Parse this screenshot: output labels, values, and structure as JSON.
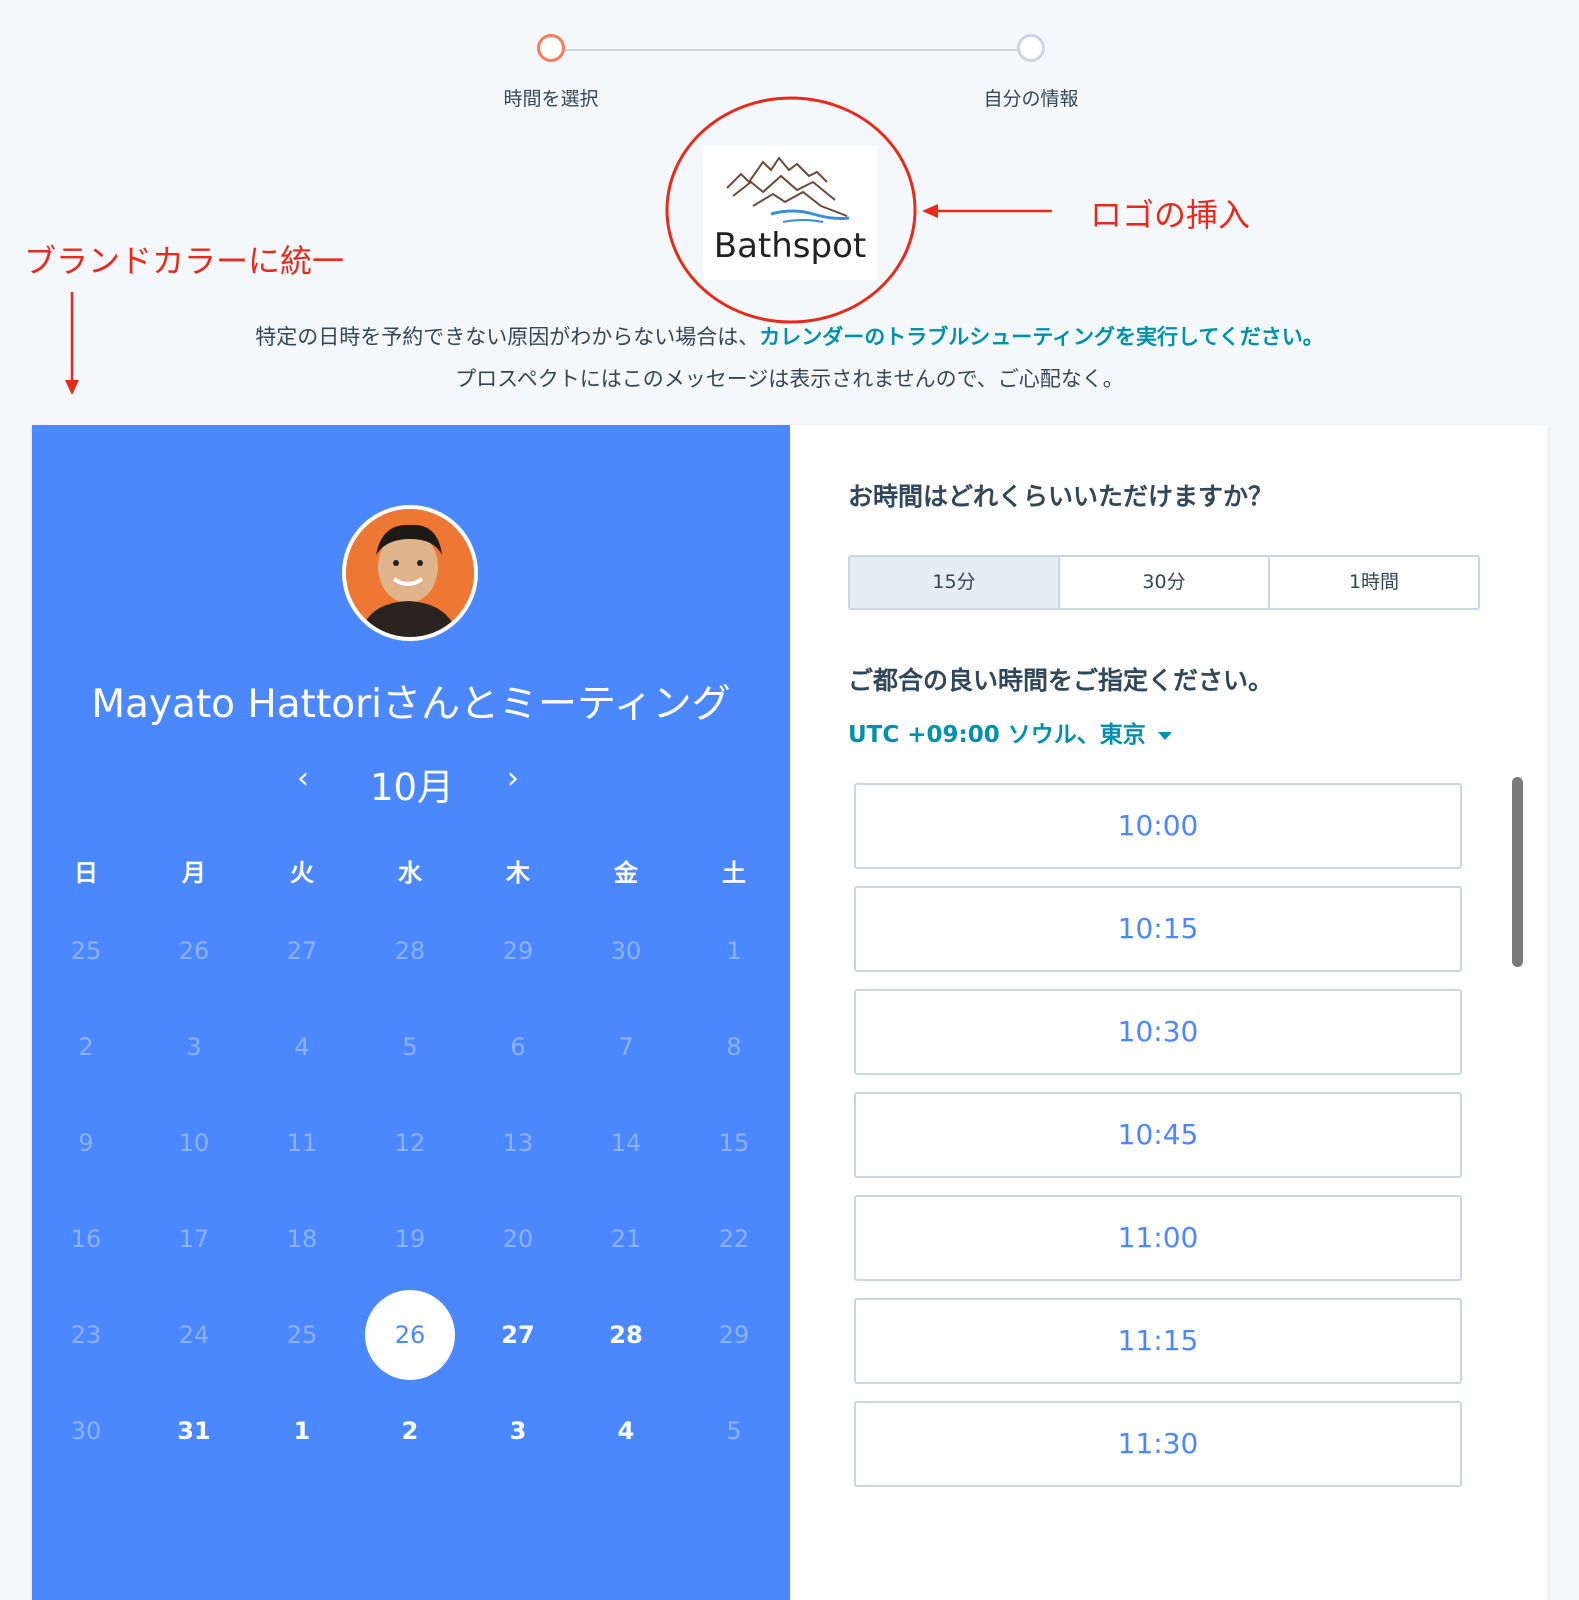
{
  "stepper": {
    "step1_label": "時間を選択",
    "step2_label": "自分の情報"
  },
  "logo": {
    "text": "Bathspot"
  },
  "annotations": {
    "logo_note": "ロゴの挿入",
    "brand_note": "ブランドカラーに統一"
  },
  "info": {
    "line1_prefix": "特定の日時を予約できない原因がわからない場合は、",
    "line1_link": "カレンダーのトラブルシューティングを実行してください。",
    "line2": "プロスペクトにはこのメッセージは表示されませんので、ご心配なく。"
  },
  "calendar": {
    "meeting_title": "Mayato Hattoriさんとミーティング",
    "prev_label": "‹",
    "next_label": "›",
    "month": "10月",
    "weekdays": [
      "日",
      "月",
      "火",
      "水",
      "木",
      "金",
      "土"
    ],
    "weeks": [
      [
        "25",
        "26",
        "27",
        "28",
        "29",
        "30",
        "1"
      ],
      [
        "2",
        "3",
        "4",
        "5",
        "6",
        "7",
        "8"
      ],
      [
        "9",
        "10",
        "11",
        "12",
        "13",
        "14",
        "15"
      ],
      [
        "16",
        "17",
        "18",
        "19",
        "20",
        "21",
        "22"
      ],
      [
        "23",
        "24",
        "25",
        "26",
        "27",
        "28",
        "29"
      ],
      [
        "30",
        "31",
        "1",
        "2",
        "3",
        "4",
        "5"
      ]
    ]
  },
  "scheduler": {
    "duration_question": "お時間はどれくらいいただけますか？",
    "durations": [
      "15分",
      "30分",
      "1時間"
    ],
    "slot_question": "ご都合の良い時間をご指定ください。",
    "timezone": "UTC +09:00 ソウル、東京",
    "slots": [
      "10:00",
      "10:15",
      "10:30",
      "10:45",
      "11:00",
      "11:15",
      "11:30"
    ]
  },
  "colors": {
    "brand": "#4c88fd",
    "accent": "#ff7a59",
    "link": "#0091ae",
    "annotation": "#e8291c"
  }
}
